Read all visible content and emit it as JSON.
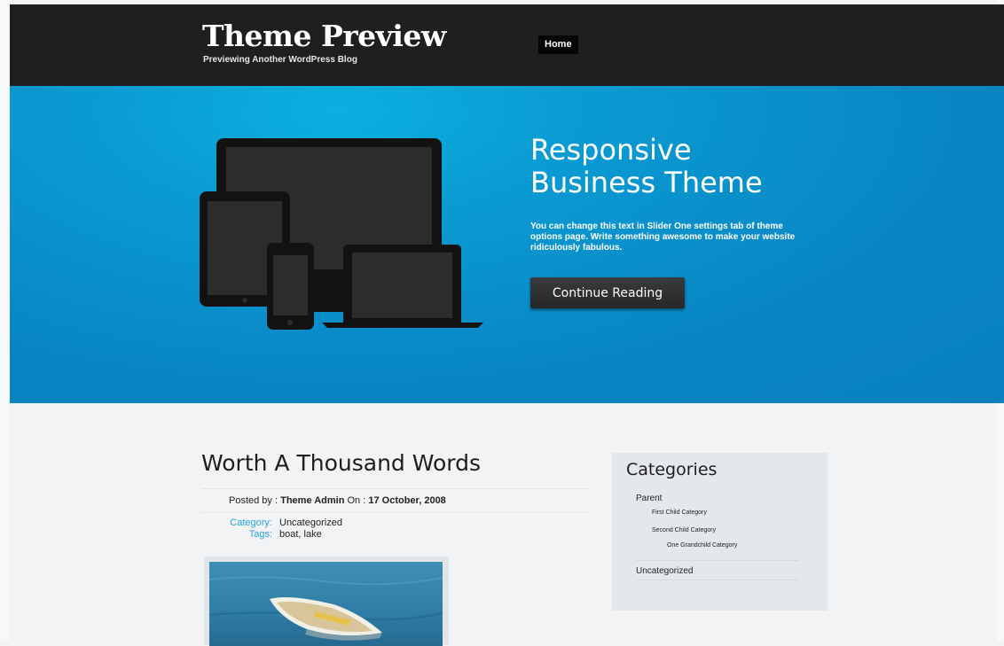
{
  "header": {
    "site_title": "Theme Preview",
    "tagline": "Previewing Another WordPress Blog",
    "nav": [
      {
        "label": "Home"
      }
    ]
  },
  "hero": {
    "title_line1": "Responsive",
    "title_line2": "Business Theme",
    "text": "You can change this text in Slider One settings tab of theme options page. Write something awesome to make your website ridiculously fabulous.",
    "button_label": "Continue Reading",
    "image_icon": "devices-illustration-icon"
  },
  "post": {
    "title": "Worth A Thousand Words",
    "posted_by_label": "Posted by :",
    "author": "Theme Admin",
    "on_label": "On :",
    "date": "17 October, 2008",
    "category_label": "Category:",
    "category_value": "Uncategorized",
    "tags_label": "Tags:",
    "tags_value": "boat, lake",
    "image_icon": "boat-photo"
  },
  "sidebar": {
    "title": "Categories",
    "categories": [
      {
        "label": "Parent"
      },
      {
        "label": "First Child Category"
      },
      {
        "label": "Second Child Category"
      },
      {
        "label": "One Grandchild Category"
      },
      {
        "label": "Uncategorized"
      }
    ]
  },
  "colors": {
    "header_bg": "#1e1f21",
    "hero_bg": "#0a9bd3",
    "accent_link": "#29a3dd",
    "button_bg": "#2f3032",
    "page_bg": "#f1f3f5",
    "sidebar_bg": "#e5e8eb"
  }
}
